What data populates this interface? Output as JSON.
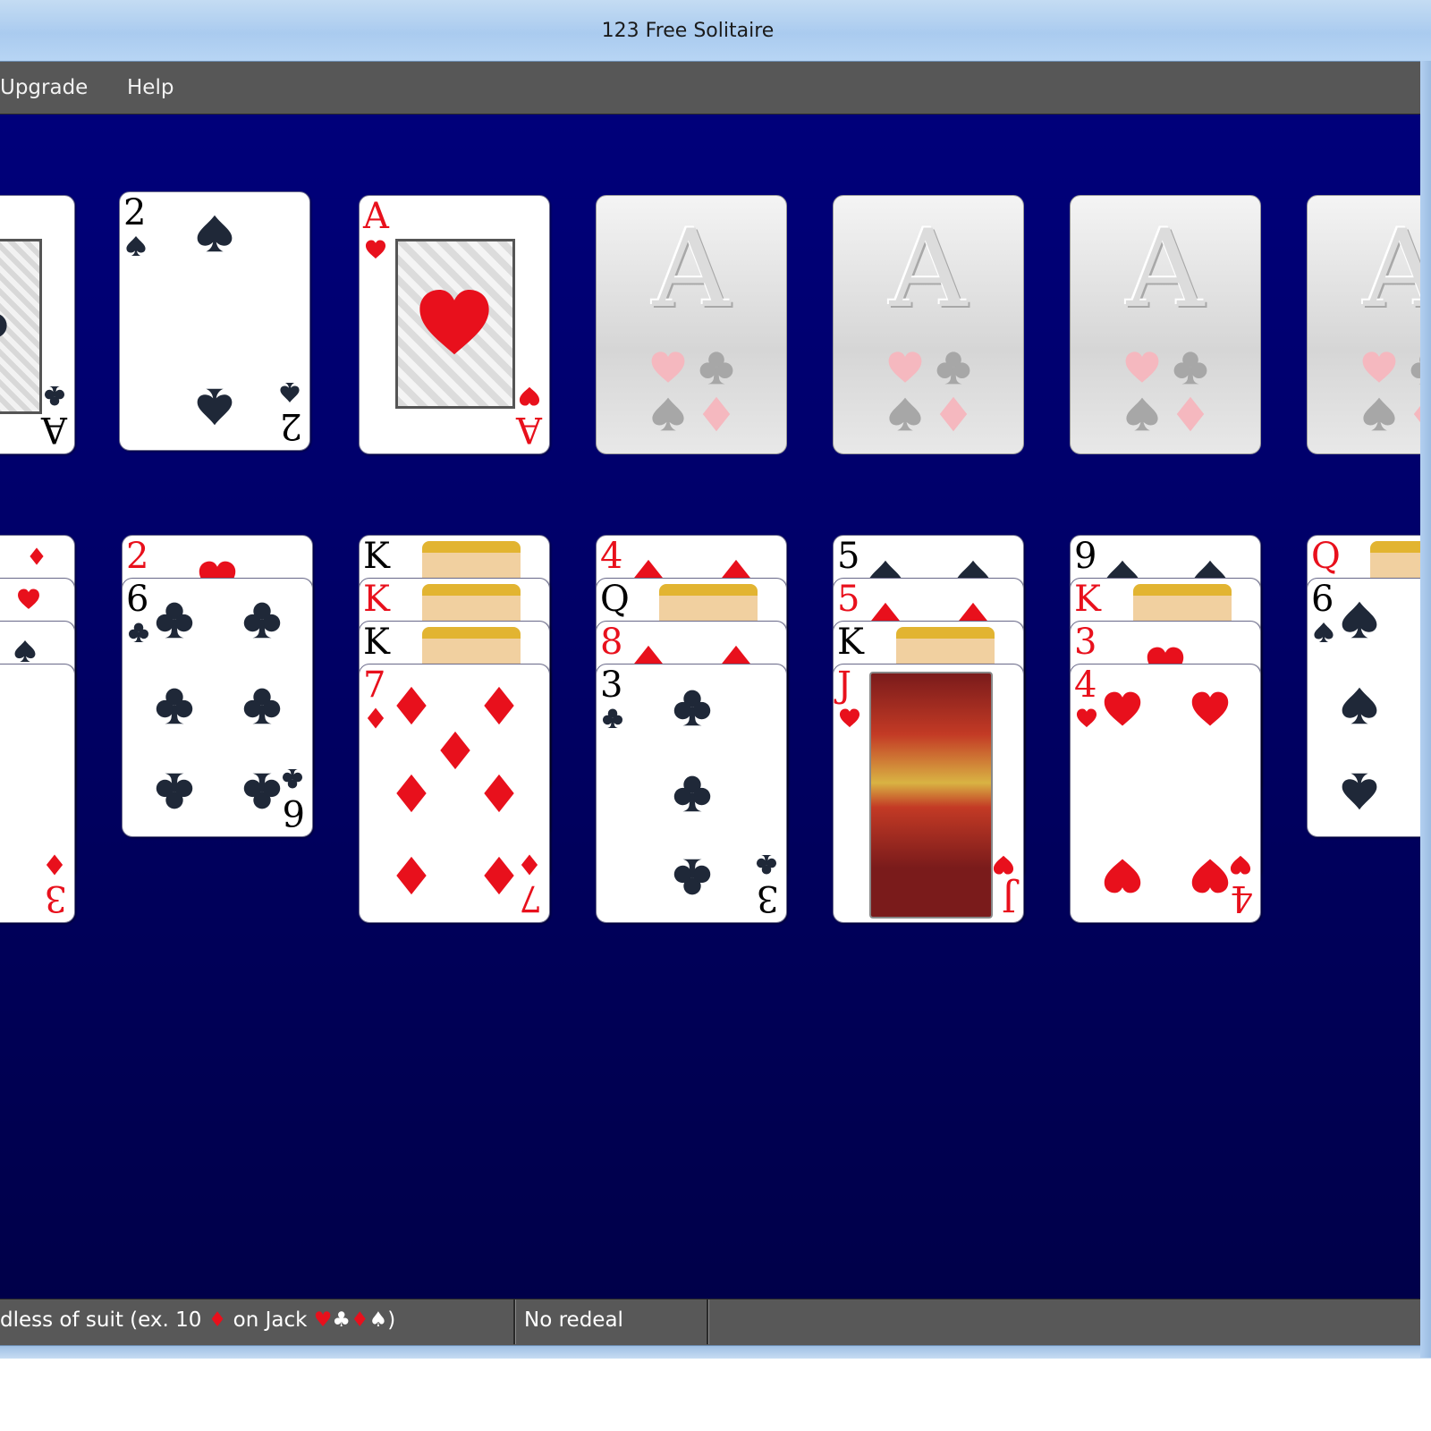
{
  "window": {
    "title": "123 Free Solitaire"
  },
  "menu": {
    "items": [
      "Upgrade",
      "Help"
    ]
  },
  "status": {
    "rule_before": "dless of suit (ex. 10 ",
    "rule_symbol1": "♦",
    "rule_after": " on Jack ",
    "rule_s1": "♥",
    "rule_s2": "♣",
    "rule_s3": "♦",
    "rule_s4": "♠",
    "rule_end": ")",
    "redeal": "No redeal"
  },
  "colors": {
    "red_suit": "#e8101c",
    "black_suit": "#1f2838",
    "felt_top": "#00007a",
    "felt_bottom": "#000049"
  },
  "foundations": {
    "label": "A",
    "count_visible": 4
  },
  "top_row": {
    "first_card_corner_rank": "A",
    "second_card_rank": "2",
    "third_card_rank": "A"
  },
  "tableau": {
    "col1": {
      "peek_rank": "",
      "last_rank": "3"
    },
    "col2": {
      "peek_ranks": [
        "2"
      ],
      "last_rank": "6"
    },
    "col3": {
      "peek_ranks": [
        "K",
        "K",
        "K"
      ],
      "last_rank": "7"
    },
    "col4": {
      "peek_ranks": [
        "4",
        "Q",
        "8"
      ],
      "last_rank": "3"
    },
    "col5": {
      "peek_ranks": [
        "5",
        "5",
        "K"
      ],
      "last_rank": "J"
    },
    "col6": {
      "peek_ranks": [
        "9",
        "K",
        "3"
      ],
      "last_rank": "4"
    },
    "col7": {
      "peek_ranks": [
        "Q"
      ],
      "last_rank": "6"
    }
  }
}
